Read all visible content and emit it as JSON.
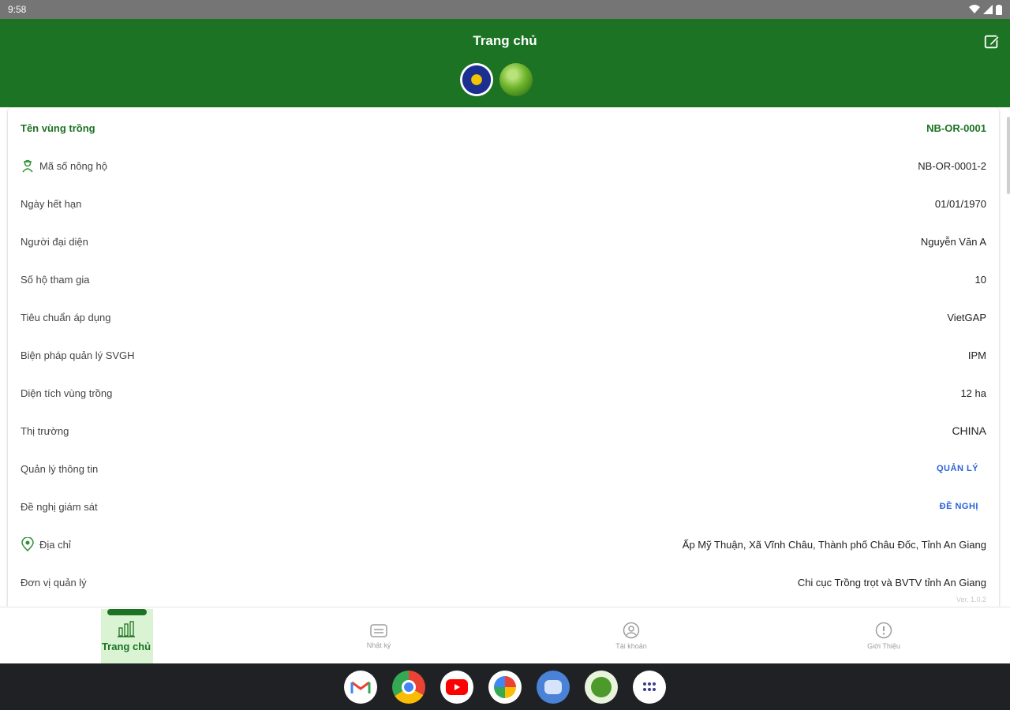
{
  "status_bar": {
    "time": "9:58"
  },
  "header": {
    "title": "Trang chủ"
  },
  "rows": [
    {
      "label": "Tên vùng trồng",
      "value": "NB-OR-0001"
    },
    {
      "label": "Mã số nông hộ",
      "value": "NB-OR-0001-2",
      "icon": "farmer-icon"
    },
    {
      "label": "Ngày hết hạn",
      "value": "01/01/1970"
    },
    {
      "label": "Người đại diện",
      "value": "Nguyễn Văn A"
    },
    {
      "label": "Số hộ tham gia",
      "value": "10"
    },
    {
      "label": "Tiêu chuẩn áp dụng",
      "value": "VietGAP"
    },
    {
      "label": "Biện pháp quản lý SVGH",
      "value": "IPM"
    },
    {
      "label": "Diện tích vùng trồng",
      "value": "12 ha"
    },
    {
      "label": "Thị trường",
      "value": "CHINA"
    },
    {
      "label": "Quản lý thông tin",
      "action": "QUẢN LÝ"
    },
    {
      "label": "Đề nghị giám sát",
      "action": "ĐỀ NGHỊ"
    },
    {
      "label": "Địa chỉ",
      "value": "Ấp Mỹ Thuận, Xã Vĩnh Châu, Thành phố Châu Đốc, Tỉnh An Giang",
      "icon": "location-pin-icon"
    },
    {
      "label": "Đơn vị quản lý",
      "value": "Chi cục Trồng trọt và BVTV tỉnh An Giang"
    }
  ],
  "version": "Ver. 1.0.2",
  "bottom_nav": [
    {
      "label": "Trang chủ",
      "icon": "home-chart-icon",
      "active": true
    },
    {
      "label": "Nhật ký",
      "icon": "journal-icon"
    },
    {
      "label": "Tài khoản",
      "icon": "account-icon"
    },
    {
      "label": "Giới Thiệu",
      "icon": "info-icon"
    }
  ],
  "dock": [
    "gmail-icon",
    "chrome-icon",
    "youtube-icon",
    "photos-icon",
    "messages-icon",
    "app-tree-icon",
    "app-drawer-icon"
  ],
  "colors": {
    "primary": "#1c7323",
    "action": "#2a62d6",
    "active_bg": "#d9f3d3"
  }
}
